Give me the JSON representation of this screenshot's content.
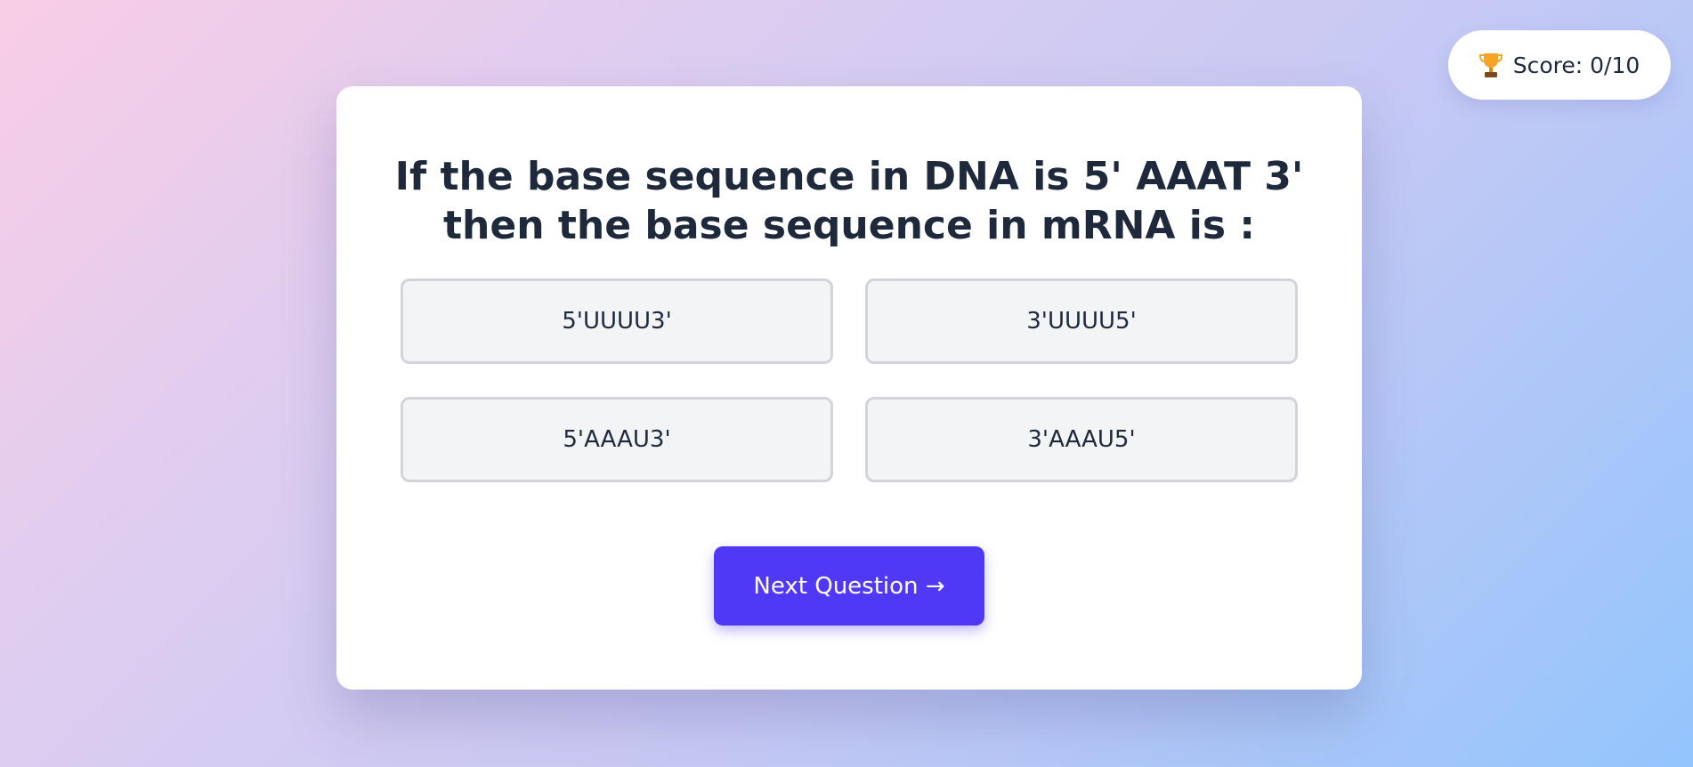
{
  "score": {
    "icon": "trophy-icon",
    "label": "Score: 0/10"
  },
  "quiz": {
    "question_line1": "If the base sequence in DNA is 5' AAAT 3'",
    "question_line2": "then the base sequence in mRNA is :",
    "options": [
      {
        "label": "5'UUUU3'"
      },
      {
        "label": "3'UUUU5'"
      },
      {
        "label": "5'AAAU3'"
      },
      {
        "label": "3'AAAU5'"
      }
    ],
    "next_label": "Next Question →"
  },
  "colors": {
    "accent": "#4f39f6",
    "text": "#1e293b",
    "option_bg": "#f3f4f6",
    "option_border": "#d1d5db"
  }
}
